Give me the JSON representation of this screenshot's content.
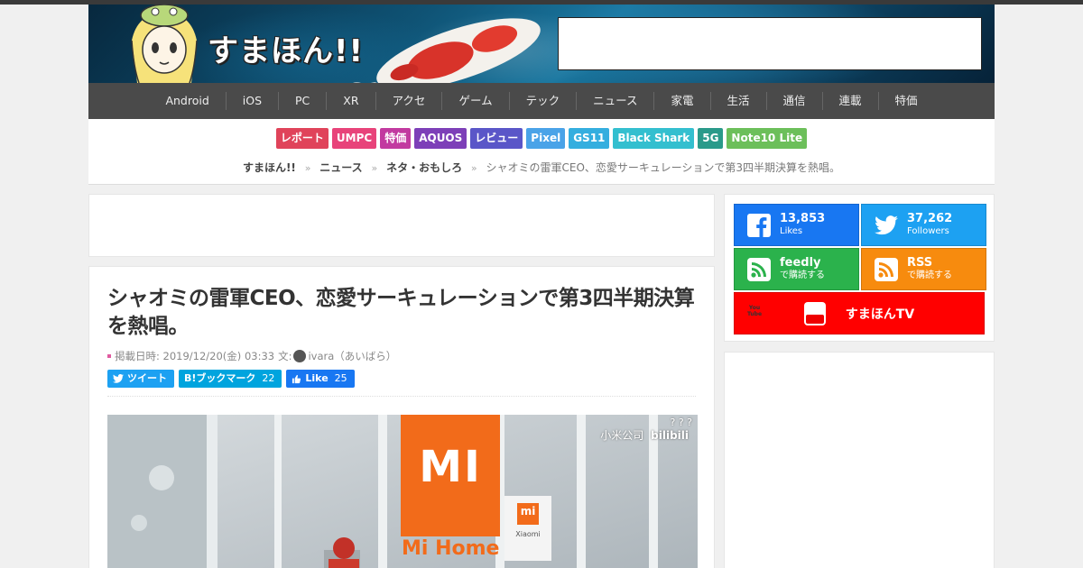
{
  "site": {
    "logo_text": "すまほん!!"
  },
  "nav": [
    "Android",
    "iOS",
    "PC",
    "XR",
    "アクセ",
    "ゲーム",
    "テック",
    "ニュース",
    "家電",
    "生活",
    "通信",
    "連載",
    "特価"
  ],
  "tags": [
    {
      "label": "レポート",
      "color": "#e0435a"
    },
    {
      "label": "UMPC",
      "color": "#e8437a"
    },
    {
      "label": "特価",
      "color": "#c23aa0"
    },
    {
      "label": "AQUOS",
      "color": "#7d3fb8"
    },
    {
      "label": "レビュー",
      "color": "#5a56c8"
    },
    {
      "label": "Pixel",
      "color": "#4aa3e8"
    },
    {
      "label": "GS11",
      "color": "#34aedf"
    },
    {
      "label": "Black Shark",
      "color": "#33bfcf"
    },
    {
      "label": "5G",
      "color": "#2a9a8a"
    },
    {
      "label": "Note10 Lite",
      "color": "#6cbf5a"
    }
  ],
  "breadcrumb": {
    "items": [
      "すまほん!!",
      "ニュース",
      "ネタ・おもしろ"
    ],
    "current": "シャオミの雷軍CEO、恋愛サーキュレーションで第3四半期決算を熱唱。",
    "separator": "»"
  },
  "article": {
    "title": "シャオミの雷軍CEO、恋愛サーキュレーションで第3四半期決算を熱唱。",
    "date": "掲載日時: 2019/12/20(金) 03:33",
    "author_label": "文:",
    "author": "ivara（あいばら）",
    "share": {
      "tweet": "ツイート",
      "hatena_label": "B!ブックマーク",
      "hatena_count": "22",
      "like_label": "Like",
      "like_count": "25"
    },
    "photo": {
      "sign": "MI",
      "store_text": "Mi Home",
      "small_logo": "mi",
      "small_text": "Xiaomi",
      "watermark": "小米公司",
      "watermark_site": "bilibili",
      "corner": "? ? ?"
    }
  },
  "sidebar": {
    "facebook": {
      "count": "13,853",
      "label": "Likes",
      "color": "#1877f2"
    },
    "twitter": {
      "count": "37,262",
      "label": "Followers",
      "color": "#1da1f2"
    },
    "feedly": {
      "title": "feedly",
      "label": "で購読する",
      "color": "#2bb24c"
    },
    "rss": {
      "title": "RSS",
      "label": "で購読する",
      "color": "#f78b0e"
    },
    "youtube": {
      "label": "すまほんTV",
      "icon_text": "You Tube",
      "color": "#ff0000"
    }
  }
}
